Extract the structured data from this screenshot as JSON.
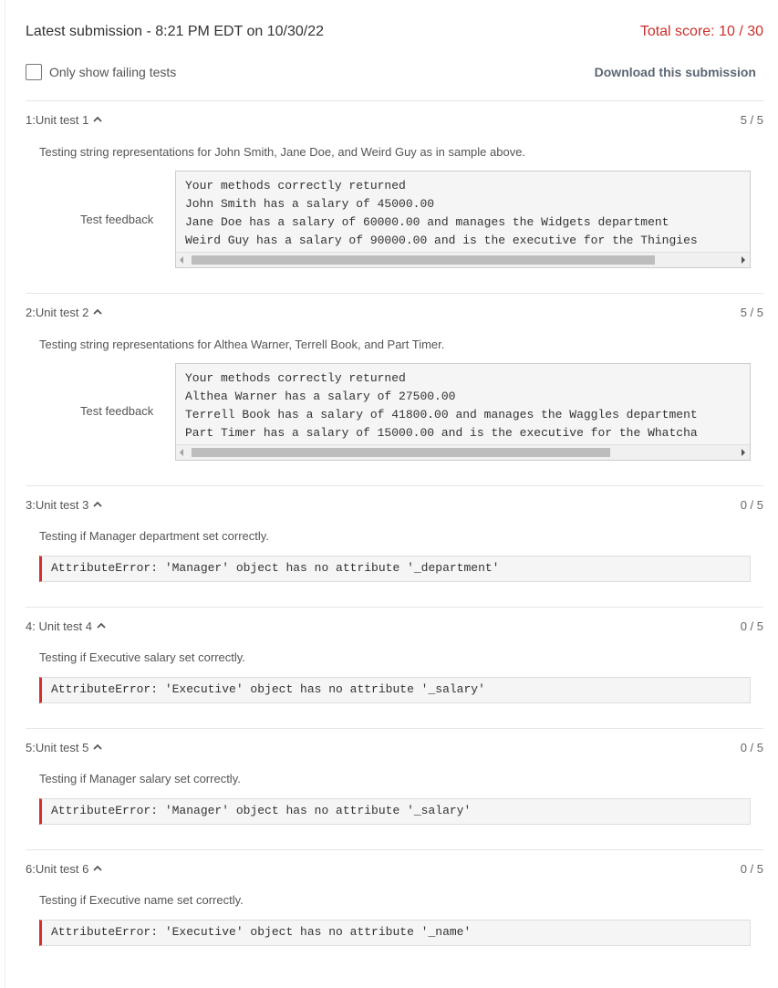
{
  "header": {
    "submission": "Latest submission - 8:21 PM EDT on 10/30/22",
    "total_score": "Total score: 10 / 30"
  },
  "filter": {
    "label": "Only show failing tests",
    "checked": false
  },
  "download_label": "Download this submission",
  "tests": [
    {
      "name": "1:Unit test 1",
      "score": "5 / 5",
      "description": "Testing string representations for John Smith, Jane Doe, and Weird Guy as in sample above.",
      "feedback_label": "Test feedback",
      "feedback": "Your methods correctly returned\nJohn Smith has a salary of 45000.00\nJane Doe has a salary of 60000.00 and manages the Widgets department\nWeird Guy has a salary of 90000.00 and is the executive for the Thingies"
    },
    {
      "name": "2:Unit test 2",
      "score": "5 / 5",
      "description": "Testing string representations for Althea Warner, Terrell Book, and Part Timer.",
      "feedback_label": "Test feedback",
      "feedback": "Your methods correctly returned\nAlthea Warner has a salary of 27500.00\nTerrell Book has a salary of 41800.00 and manages the Waggles department\nPart Timer has a salary of 15000.00 and is the executive for the Whatcha"
    },
    {
      "name": "3:Unit test 3",
      "score": "0 / 5",
      "description": "Testing if Manager department set correctly.",
      "error": "AttributeError: 'Manager' object has no attribute '_department'"
    },
    {
      "name": "4: Unit test 4",
      "score": "0 / 5",
      "description": "Testing if Executive salary set correctly.",
      "error": "AttributeError: 'Executive' object has no attribute '_salary'"
    },
    {
      "name": "5:Unit test 5",
      "score": "0 / 5",
      "description": "Testing if Manager salary set correctly.",
      "error": "AttributeError: 'Manager' object has no attribute '_salary'"
    },
    {
      "name": "6:Unit test 6",
      "score": "0 / 5",
      "description": "Testing if Executive name set correctly.",
      "error": "AttributeError: 'Executive' object has no attribute '_name'"
    }
  ],
  "colors": {
    "score_red": "#c9302c",
    "error_bar": "#d32f2f"
  }
}
